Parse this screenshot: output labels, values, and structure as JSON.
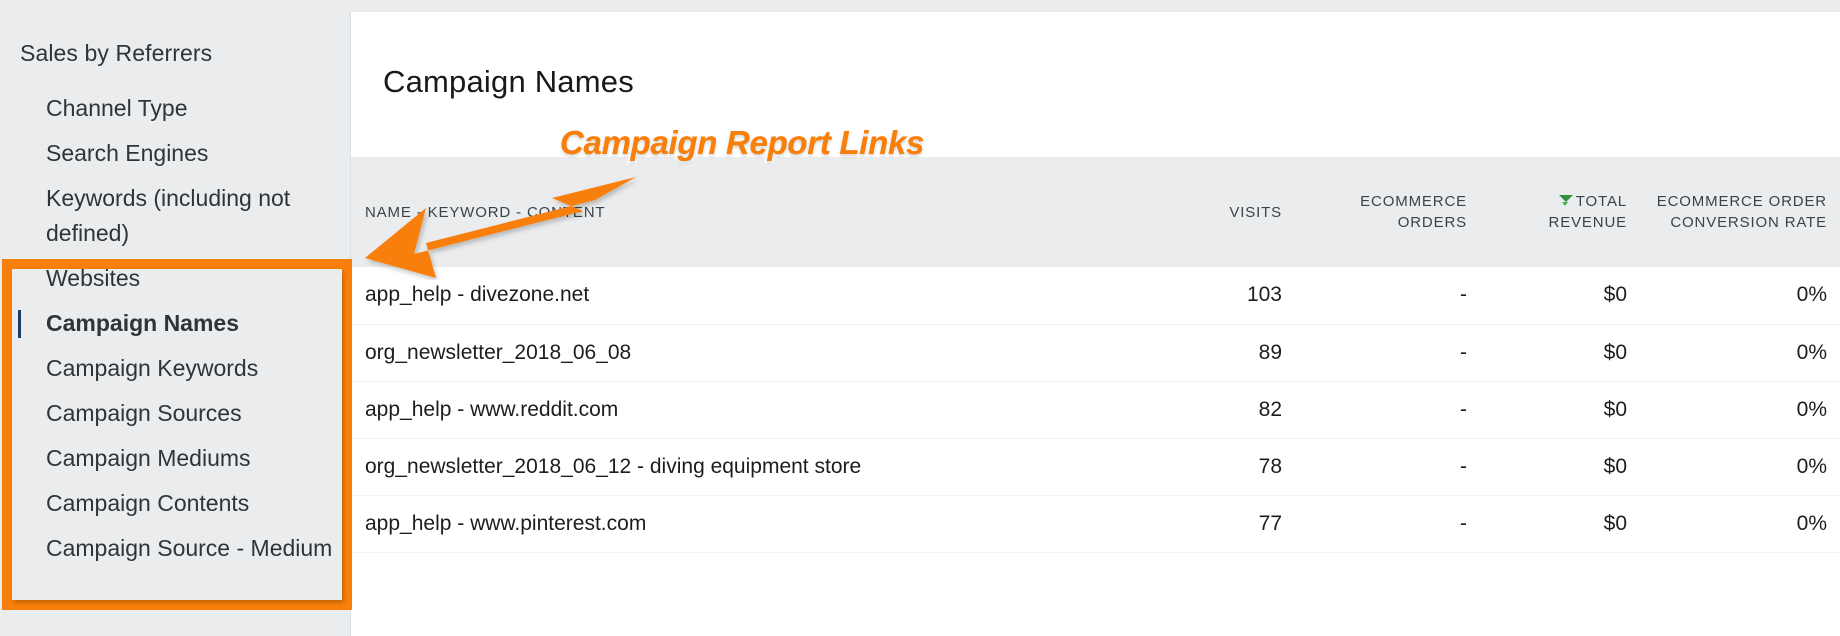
{
  "sidebar": {
    "title": "Sales by Referrers",
    "items": [
      {
        "label": "Channel Type",
        "active": false,
        "wrap": false
      },
      {
        "label": "Search Engines",
        "active": false,
        "wrap": false
      },
      {
        "label": "Keywords (including not defined)",
        "active": false,
        "wrap": true
      },
      {
        "label": "Websites",
        "active": false,
        "wrap": false
      },
      {
        "label": "Campaign Names",
        "active": true,
        "wrap": false
      },
      {
        "label": "Campaign Keywords",
        "active": false,
        "wrap": false
      },
      {
        "label": "Campaign Sources",
        "active": false,
        "wrap": false
      },
      {
        "label": "Campaign Mediums",
        "active": false,
        "wrap": false
      },
      {
        "label": "Campaign Contents",
        "active": false,
        "wrap": false
      },
      {
        "label": "Campaign Source - Medium",
        "active": false,
        "wrap": false
      }
    ]
  },
  "main": {
    "report_title": "Campaign Names"
  },
  "annotation": {
    "label": "Campaign Report Links",
    "color": "#f97f0b",
    "arrow_icon": "arrow-down-left-icon",
    "box_color": "#f97f0b"
  },
  "table": {
    "columns": [
      {
        "key": "name",
        "label": "NAME - KEYWORD - CONTENT",
        "align": "left",
        "sorted": false
      },
      {
        "key": "visits",
        "label": "VISITS",
        "align": "right",
        "sorted": false
      },
      {
        "key": "orders",
        "label": "ECOMMERCE ORDERS",
        "align": "right",
        "sorted": false
      },
      {
        "key": "revenue",
        "label": "TOTAL REVENUE",
        "align": "right",
        "sorted": true
      },
      {
        "key": "convrate",
        "label": "ECOMMERCE ORDER CONVERSION RATE",
        "align": "right",
        "sorted": false
      }
    ],
    "sort_indicator": {
      "column": "revenue",
      "direction": "desc",
      "icon": "sort-descending-icon",
      "color": "#2f9141"
    },
    "rows": [
      {
        "name": "app_help - divezone.net",
        "visits": "103",
        "orders": "-",
        "revenue": "$0",
        "convrate": "0%"
      },
      {
        "name": "org_newsletter_2018_06_08",
        "visits": "89",
        "orders": "-",
        "revenue": "$0",
        "convrate": "0%"
      },
      {
        "name": "app_help - www.reddit.com",
        "visits": "82",
        "orders": "-",
        "revenue": "$0",
        "convrate": "0%"
      },
      {
        "name": "org_newsletter_2018_06_12 - diving equipment store",
        "visits": "78",
        "orders": "-",
        "revenue": "$0",
        "convrate": "0%"
      },
      {
        "name": "app_help - www.pinterest.com",
        "visits": "77",
        "orders": "-",
        "revenue": "$0",
        "convrate": "0%"
      }
    ]
  }
}
